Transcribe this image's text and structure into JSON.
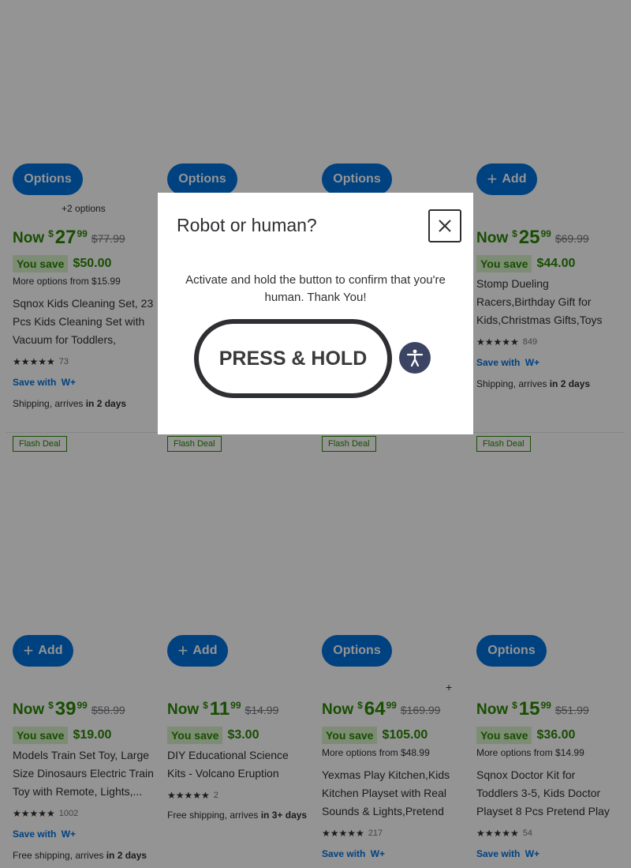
{
  "row1": [
    {
      "button": "Options",
      "button_type": "options",
      "more_options": "+2 options",
      "now": "Now",
      "cur": "$",
      "whole": "27",
      "cents": "99",
      "was": "$77.99",
      "you_save": "You save",
      "save_amt": "$50.00",
      "options_from": "More options from $15.99",
      "title": "Sqnox Kids Cleaning Set, 23 Pcs Kids Cleaning Set with Vacuum for Toddlers, Preten...",
      "stars": "★★★★★",
      "rating_count": "73",
      "save_with": "Save with",
      "wplus": "W+",
      "ship_pre": "Shipping, arrives ",
      "ship_bold": "in 2 days"
    },
    {
      "button": "Options",
      "button_type": "options"
    },
    {
      "button": "Options",
      "button_type": "options"
    },
    {
      "button": "Add",
      "button_type": "add",
      "now": "Now",
      "cur": "$",
      "whole": "25",
      "cents": "99",
      "was": "$69.99",
      "you_save": "You save",
      "save_amt": "$44.00",
      "title": "Stomp Dueling Racers,Birthday Gift for Kids,Christmas Gifts,Toys fo...",
      "stars": "★★★★★",
      "rating_count": "849",
      "save_with": "Save with",
      "wplus": "W+",
      "ship_pre": "Shipping, arrives ",
      "ship_bold": "in 2 days"
    }
  ],
  "row2": [
    {
      "flash": "Flash Deal",
      "button": "Add",
      "button_type": "add",
      "now": "Now",
      "cur": "$",
      "whole": "39",
      "cents": "99",
      "was": "$58.99",
      "you_save": "You save",
      "save_amt": "$19.00",
      "title": "Models Train Set Toy, Large Size Dinosaurs Electric Train Toy with Remote, Lights,...",
      "stars": "★★★★★",
      "rating_count": "1002",
      "save_with": "Save with",
      "wplus": "W+",
      "ship_pre": "Free shipping, arrives ",
      "ship_bold": "in 2 days"
    },
    {
      "flash": "Flash Deal",
      "button": "Add",
      "button_type": "add",
      "now": "Now",
      "cur": "$",
      "whole": "11",
      "cents": "99",
      "was": "$14.99",
      "you_save": "You save",
      "save_amt": "$3.00",
      "title": "DIY Educational Science Kits - Volcano Eruption",
      "stars": "★★★★★",
      "rating_count": "2",
      "ship_pre": "Free shipping, arrives ",
      "ship_bold": "in 3+ days"
    },
    {
      "flash": "Flash Deal",
      "button": "Options",
      "button_type": "options",
      "now": "Now",
      "cur": "$",
      "whole": "64",
      "cents": "99",
      "was": "$169.99",
      "you_save": "You save",
      "save_amt": "$105.00",
      "options_from": "More options from $48.99",
      "title": "Yexmas Play Kitchen,Kids Kitchen Playset with Real Sounds & Lights,Pretend Pla...",
      "stars": "★★★★★",
      "rating_count": "217",
      "save_with": "Save with",
      "wplus": "W+"
    },
    {
      "flash": "Flash Deal",
      "button": "Options",
      "button_type": "options",
      "now": "Now",
      "cur": "$",
      "whole": "15",
      "cents": "99",
      "was": "$51.99",
      "you_save": "You save",
      "save_amt": "$36.00",
      "options_from": "More options from $14.99",
      "title": "Sqnox Doctor Kit for Toddlers 3-5, Kids Doctor Playset 8 Pcs Pretend Play with School Ba...",
      "stars": "★★★★★",
      "rating_count": "54",
      "save_with": "Save with",
      "wplus": "W+"
    }
  ],
  "modal": {
    "title": "Robot or human?",
    "message": "Activate and hold the button to confirm that you're human. Thank You!",
    "hold_label": "PRESS & HOLD",
    "close_icon": "close-icon",
    "accessibility_icon": "accessibility-icon"
  },
  "misc": {
    "plus": "+"
  },
  "colors": {
    "accent": "#0071dc",
    "green": "#2a8703",
    "save_bg": "#d7f1c9",
    "overlay": "rgba(0,0,0,0.42)",
    "a11y": "#3c4464"
  }
}
